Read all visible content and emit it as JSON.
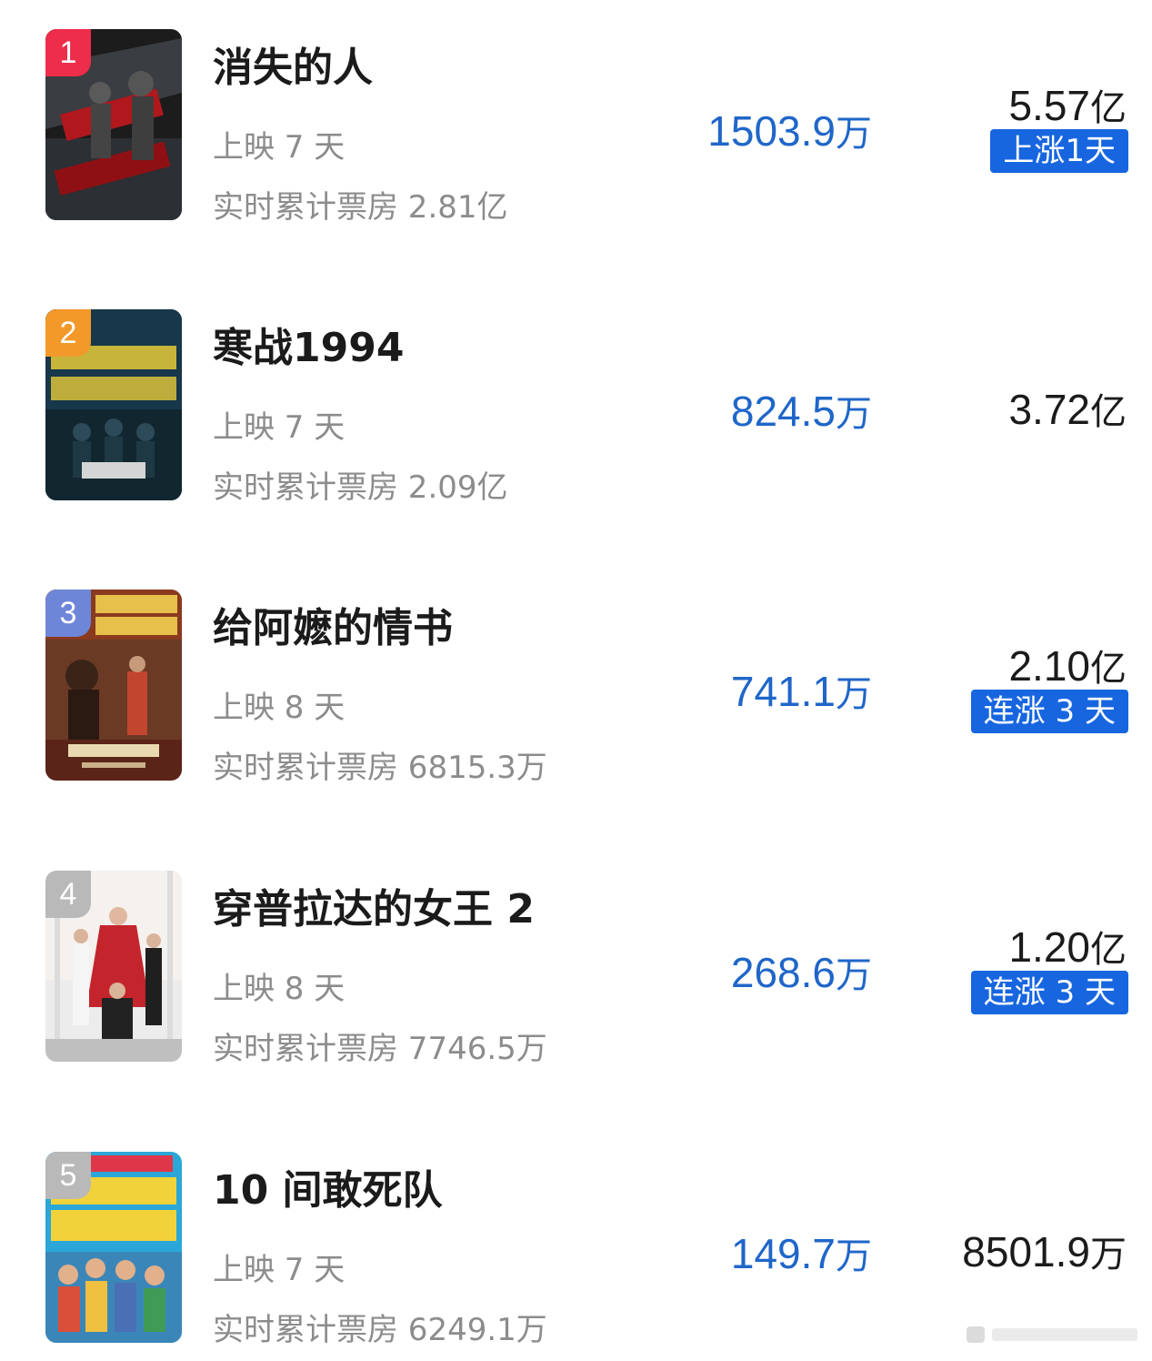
{
  "labels": {
    "days_prefix": "上映",
    "days_suffix": "天",
    "cumulative_prefix": "实时累计票房"
  },
  "colors": {
    "rank_1": "#ee2d4a",
    "rank_2": "#f2992a",
    "rank_3": "#6e86d8",
    "rank_other": "#b9b9b9",
    "today_value": "#1f66c9",
    "trend_tag_bg": "#1766e0"
  },
  "movies": [
    {
      "rank": "1",
      "title": "消失的人",
      "days": "上映 7 天",
      "cumulative": "实时累计票房 2.81亿",
      "today_value": "1503.9",
      "today_unit": "万",
      "forecast_value": "5.57",
      "forecast_unit": "亿",
      "trend": "上涨1天"
    },
    {
      "rank": "2",
      "title": "寒战1994",
      "days": "上映 7 天",
      "cumulative": "实时累计票房 2.09亿",
      "today_value": "824.5",
      "today_unit": "万",
      "forecast_value": "3.72",
      "forecast_unit": "亿",
      "trend": ""
    },
    {
      "rank": "3",
      "title": "给阿嬷的情书",
      "days": "上映 8 天",
      "cumulative": "实时累计票房 6815.3万",
      "today_value": "741.1",
      "today_unit": "万",
      "forecast_value": "2.10",
      "forecast_unit": "亿",
      "trend": "连涨 3 天"
    },
    {
      "rank": "4",
      "title": "穿普拉达的女王 2",
      "days": "上映 8 天",
      "cumulative": "实时累计票房 7746.5万",
      "today_value": "268.6",
      "today_unit": "万",
      "forecast_value": "1.20",
      "forecast_unit": "亿",
      "trend": "连涨 3 天"
    },
    {
      "rank": "5",
      "title": "10 间敢死队",
      "days": "上映 7 天",
      "cumulative": "实时累计票房 6249.1万",
      "today_value": "149.7",
      "today_unit": "万",
      "forecast_value": "8501.9",
      "forecast_unit": "万",
      "trend": ""
    }
  ]
}
